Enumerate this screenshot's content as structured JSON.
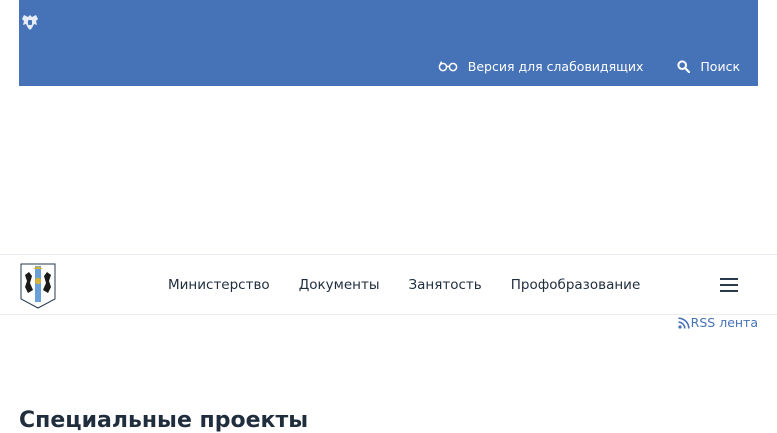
{
  "topbar": {
    "accessibility_label": "Версия для слабовидящих",
    "search_label": "Поиск"
  },
  "nav": {
    "items": [
      "Министерство",
      "Документы",
      "Занятость",
      "Профобразование"
    ]
  },
  "rss": {
    "label": "RSS лента"
  },
  "main": {
    "section_title": "Специальные проекты"
  },
  "colors": {
    "brand_blue": "#4673b8",
    "text_dark": "#1f2d3d"
  }
}
